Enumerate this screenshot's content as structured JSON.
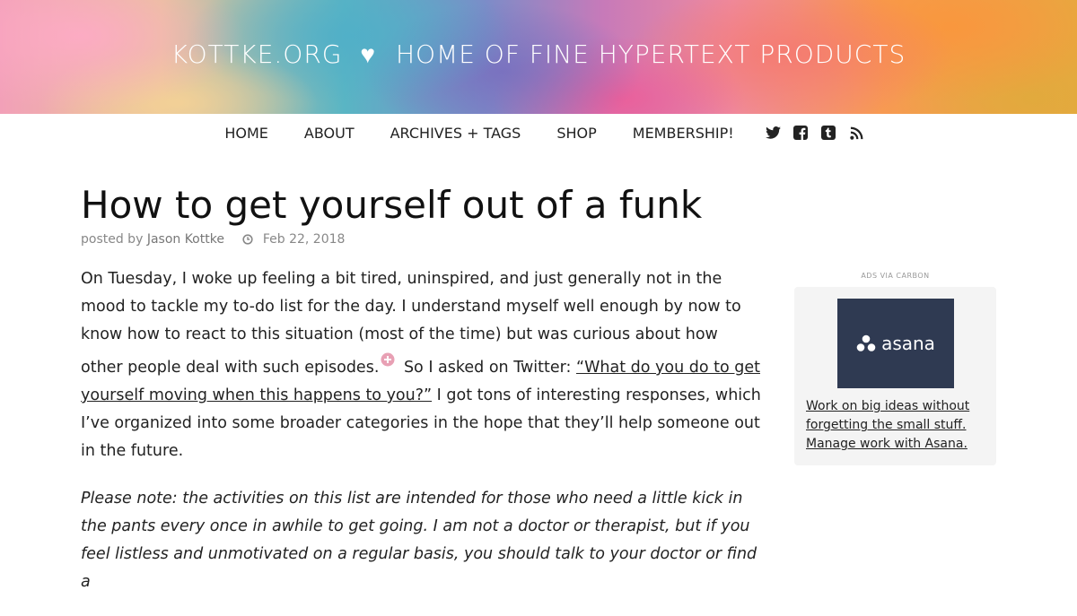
{
  "header": {
    "site_name": "KOTTKE.ORG",
    "heart": "♥",
    "tagline": "HOME OF FINE HYPERTEXT PRODUCTS"
  },
  "nav": {
    "items": [
      {
        "label": "HOME"
      },
      {
        "label": "ABOUT"
      },
      {
        "label": "ARCHIVES + TAGS"
      },
      {
        "label": "SHOP"
      },
      {
        "label": "MEMBERSHIP!"
      }
    ],
    "social_icons": [
      "twitter-icon",
      "facebook-icon",
      "tumblr-icon",
      "rss-icon"
    ]
  },
  "post": {
    "title": "How to get yourself out of a funk",
    "posted_by_label": "posted by",
    "author": "Jason Kottke",
    "date": "Feb 22, 2018",
    "p1_before": "On Tuesday, I woke up feeling a bit tired, uninspired, and just generally not in the mood to tackle my to-do list for the day. I understand myself well enough by now to know how to react to this situation (most of the time) but was curious about how other people deal with such episodes.",
    "p1_middle": " So I asked on Twitter: ",
    "p1_link": "“What do you do to get yourself moving when this happens to you?”",
    "p1_after": " I got tons of interesting responses, which I’ve organized into some broader categories in the hope that they’ll help someone out in the future.",
    "p2": "Please note: the activities on this list are intended for those who need a little kick in the pants every once in awhile to get going. I am not a doctor or therapist, but if you feel listless and unmotivated on a regular basis, you should talk to your doctor or find a"
  },
  "ad": {
    "label": "ADS VIA CARBON",
    "logo_text": "asana",
    "text": "Work on big ideas without forgetting the small stuff. Manage work with Asana."
  },
  "colors": {
    "ad_image_bg": "#2f3a52",
    "plus_icon": "#e8a0b4",
    "text": "#222222"
  }
}
